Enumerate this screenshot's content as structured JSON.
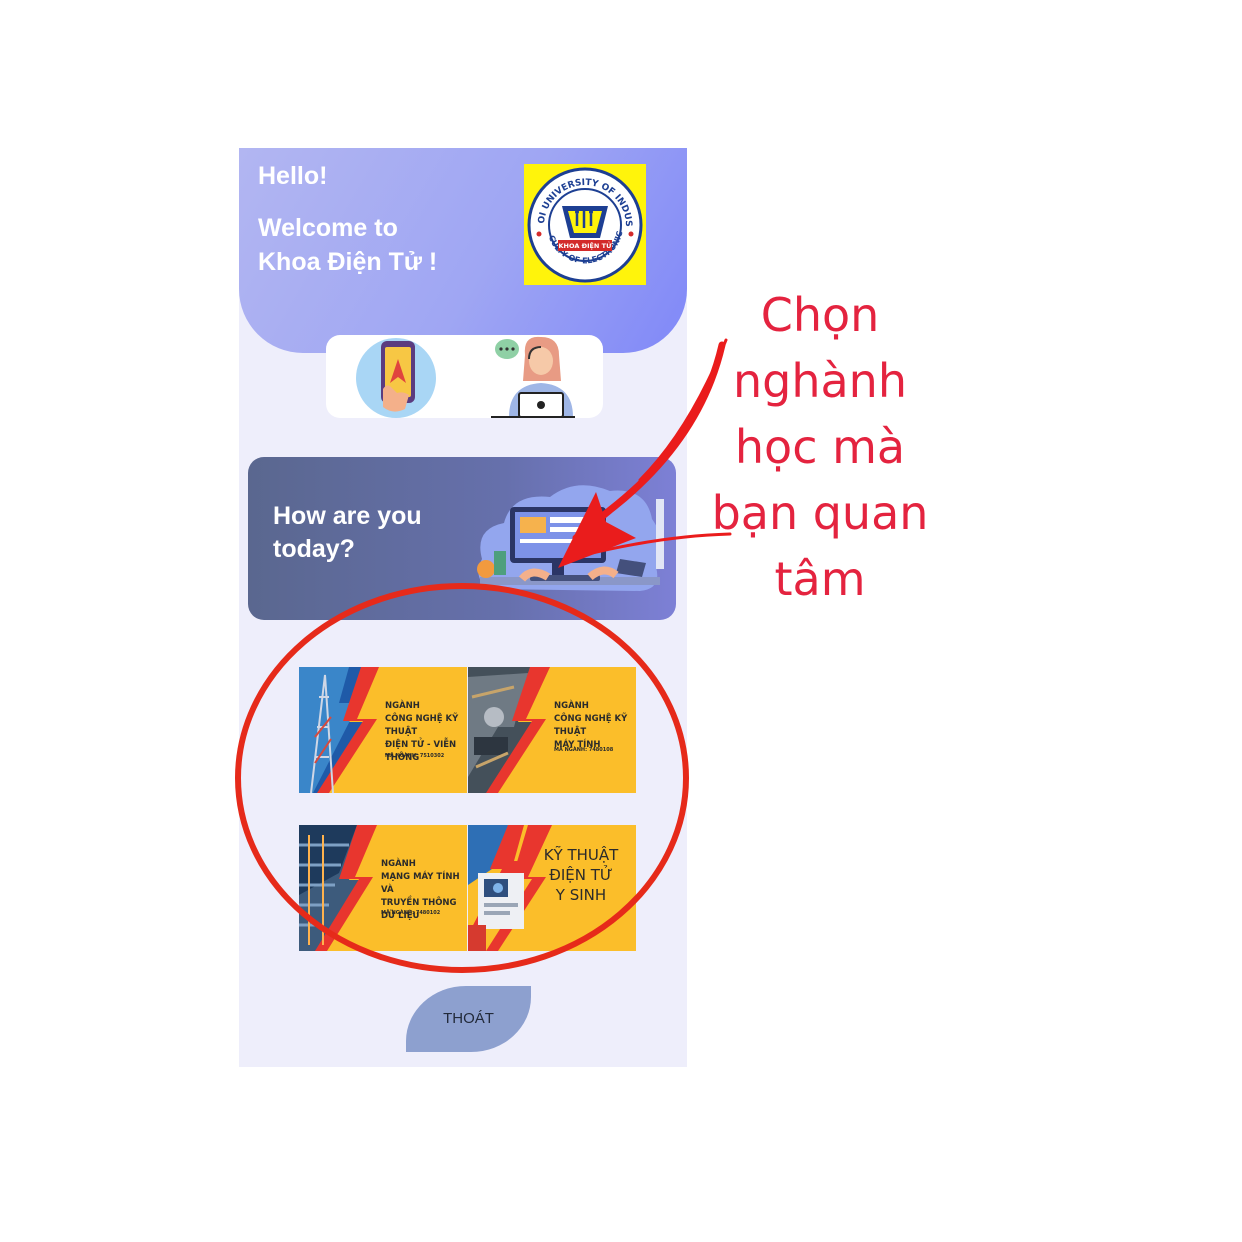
{
  "header": {
    "greeting": "Hello!",
    "welcome_line1": "Welcome to",
    "welcome_line2": "Khoa Điện Tử !",
    "logo": {
      "top_text": "HANOI UNIVERSITY OF INDUSTRY",
      "bottom_text": "FACULTY OF ELECTRONICS",
      "center_text": "KHOA ĐIỆN TỬ"
    }
  },
  "quick_actions": [
    {
      "icon": "map-navigation-icon"
    },
    {
      "icon": "support-agent-icon"
    }
  ],
  "banner": {
    "line1": "How are you",
    "line2": "today?"
  },
  "majors": [
    {
      "title": "NGÀNH\nCÔNG NGHỆ KỸ THUẬT\nĐIỆN TỬ - VIỄN THÔNG",
      "code": "MÃ NGÀNH: 7510302"
    },
    {
      "title": "NGÀNH\nCÔNG NGHỆ KỸ THUẬT\nMÁY TÍNH",
      "code": "MÃ NGÀNH: 7480108"
    },
    {
      "title": "NGÀNH\nMẠNG MÁY TÍNH VÀ\nTRUYỀN THÔNG DỮ LIỆU",
      "code": "MÃ NGÀNH: 7480102"
    },
    {
      "title": "KỸ THUẬT\nĐIỆN TỬ\nY SINH",
      "code": ""
    }
  ],
  "exit_label": "THOÁT",
  "annotation": {
    "text_lines": [
      "Chọn",
      "nghành",
      "học mà",
      "bạn quan",
      "tâm"
    ],
    "color": "#e4233f"
  }
}
